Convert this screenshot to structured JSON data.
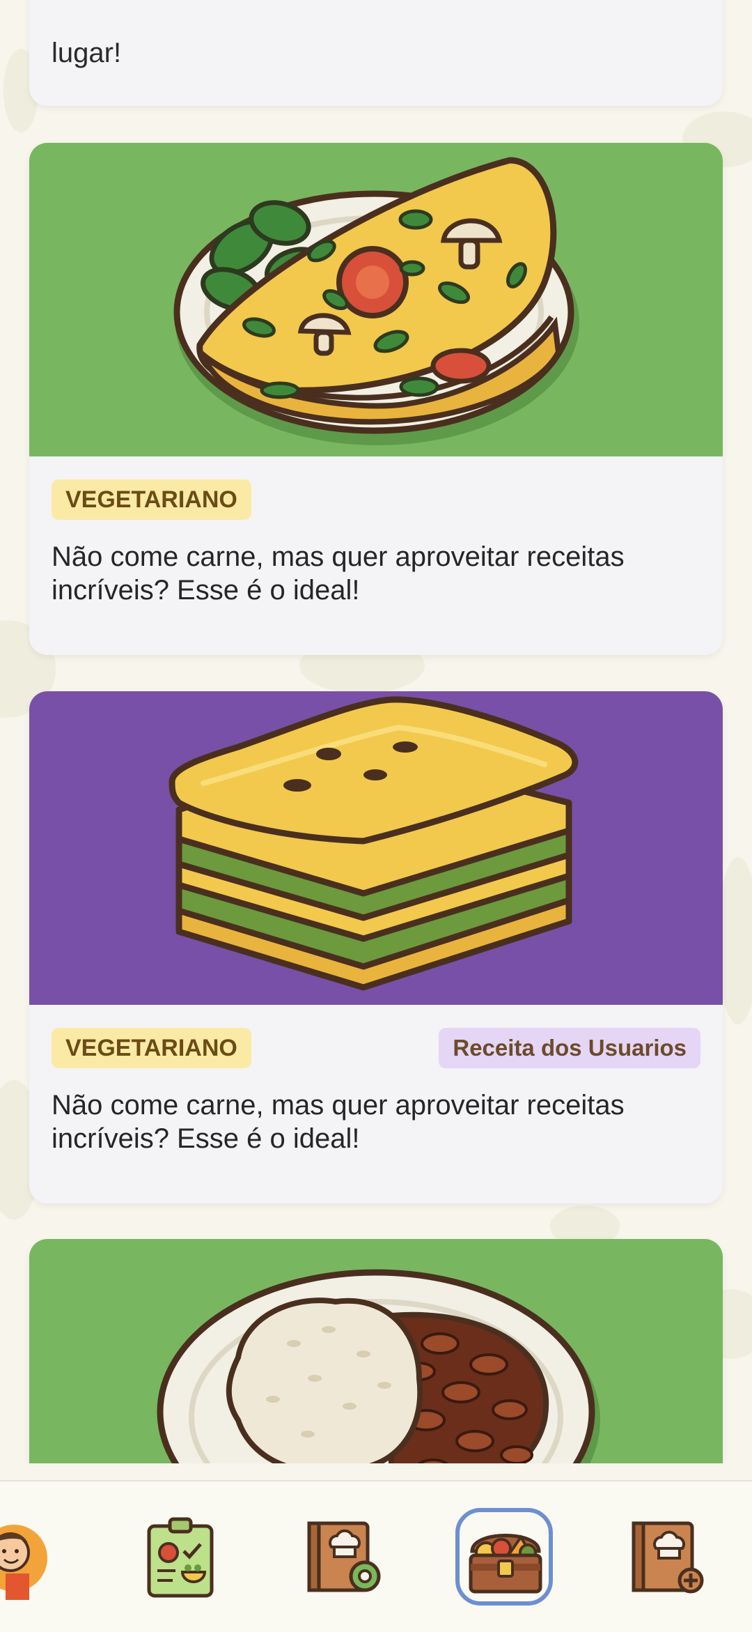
{
  "feed": {
    "top_card": {
      "description_tail": "lugar!"
    },
    "cards": [
      {
        "image": "omelette-illustration",
        "image_bg": "#78b760",
        "tag": "VEGETARIANO",
        "description": "Não come carne, mas quer aproveitar receitas incríveis? Esse é o ideal!"
      },
      {
        "image": "lasagna-illustration",
        "image_bg": "#7850a8",
        "tag": "VEGETARIANO",
        "user_badge": "Receita dos Usuarios",
        "description": "Não come carne, mas quer aproveitar receitas incríveis? Esse é o ideal!"
      },
      {
        "image": "rice-and-beans-illustration",
        "image_bg": "#78b760"
      }
    ]
  },
  "bottom_nav": {
    "items": [
      {
        "icon": "profile-avatar-icon",
        "active": false
      },
      {
        "icon": "meal-plan-checklist-icon",
        "active": false
      },
      {
        "icon": "recipe-book-settings-icon",
        "active": false
      },
      {
        "icon": "food-treasure-chest-icon",
        "active": true
      },
      {
        "icon": "add-recipe-book-icon",
        "active": false
      }
    ]
  },
  "colors": {
    "background": "#f7f5ec",
    "card": "#f4f3f6",
    "green": "#78b760",
    "purple": "#7850a8",
    "veg_badge": "#fbeaa6",
    "user_badge": "#e6d6f5",
    "active_nav_ring": "#6d8fd0"
  }
}
